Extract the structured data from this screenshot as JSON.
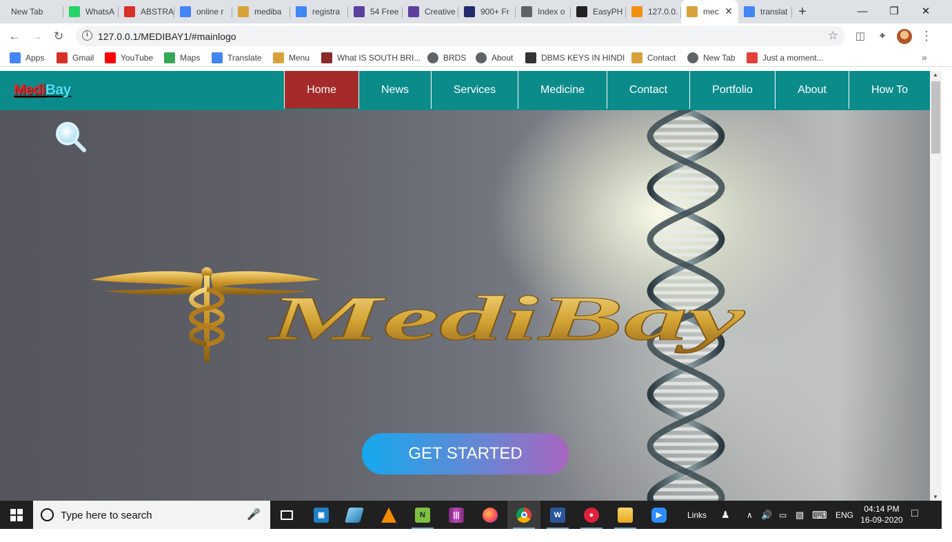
{
  "browser": {
    "tabs": [
      {
        "title": "New Tab",
        "icon": "none",
        "color": "#dee1e6"
      },
      {
        "title": "WhatsA",
        "icon": "whatsapp-icon",
        "color": "#25d366"
      },
      {
        "title": "ABSTRA",
        "icon": "gmail-icon",
        "color": "#d93025"
      },
      {
        "title": "online r",
        "icon": "google-icon",
        "color": "#4285f4"
      },
      {
        "title": "mediba",
        "icon": "medibay-icon",
        "color": "#d8a23a"
      },
      {
        "title": "registra",
        "icon": "google-icon",
        "color": "#4285f4"
      },
      {
        "title": "54 Free",
        "icon": "colorlib-icon",
        "color": "#5b3f9c"
      },
      {
        "title": "Creative",
        "icon": "colorlib-icon",
        "color": "#5b3f9c"
      },
      {
        "title": "900+ Fr",
        "icon": "w3-icon",
        "color": "#222a6b"
      },
      {
        "title": "Index o",
        "icon": "globe-icon",
        "color": "#5f6368"
      },
      {
        "title": "EasyPH",
        "icon": "easyphp-icon",
        "color": "#222222"
      },
      {
        "title": "127.0.0.",
        "icon": "phpmyadmin-icon",
        "color": "#f29111"
      },
      {
        "title": "mec",
        "icon": "medibay-icon",
        "color": "#d8a23a",
        "active": true
      },
      {
        "title": "translat",
        "icon": "google-icon",
        "color": "#4285f4"
      }
    ],
    "new_tab_icon": "plus-icon",
    "address": {
      "url": "127.0.0.1/MEDIBAY1/#mainlogo"
    },
    "bookmarks": [
      {
        "label": "Apps",
        "icon": "apps-grid-icon"
      },
      {
        "label": "Gmail",
        "icon": "gmail-icon"
      },
      {
        "label": "YouTube",
        "icon": "youtube-icon"
      },
      {
        "label": "Maps",
        "icon": "maps-icon"
      },
      {
        "label": "Translate",
        "icon": "translate-icon"
      },
      {
        "label": "Menu",
        "icon": "medibay-icon"
      },
      {
        "label": "What IS SOUTH BRI...",
        "icon": "image-icon"
      },
      {
        "label": "BRDS",
        "icon": "globe-icon"
      },
      {
        "label": "About",
        "icon": "globe-icon"
      },
      {
        "label": "DBMS KEYS IN HINDI",
        "icon": "glasses-icon"
      },
      {
        "label": "Contact",
        "icon": "medibay-icon"
      },
      {
        "label": "New Tab",
        "icon": "globe-icon"
      },
      {
        "label": "Just a moment...",
        "icon": "loading-icon"
      }
    ]
  },
  "site": {
    "logo": {
      "part1": "Medi",
      "part2": "Bay"
    },
    "nav": [
      "Home",
      "News",
      "Services",
      "Medicine",
      "Contact",
      "Portfolio",
      "About",
      "How To"
    ],
    "active_nav": "Home",
    "hero": {
      "brand_text": "MediBay",
      "cta_label": "GET STARTED"
    }
  },
  "taskbar": {
    "search_placeholder": "Type here to search",
    "links_label": "Links",
    "language": "ENG",
    "time": "04:14 PM",
    "date": "16-09-2020"
  }
}
